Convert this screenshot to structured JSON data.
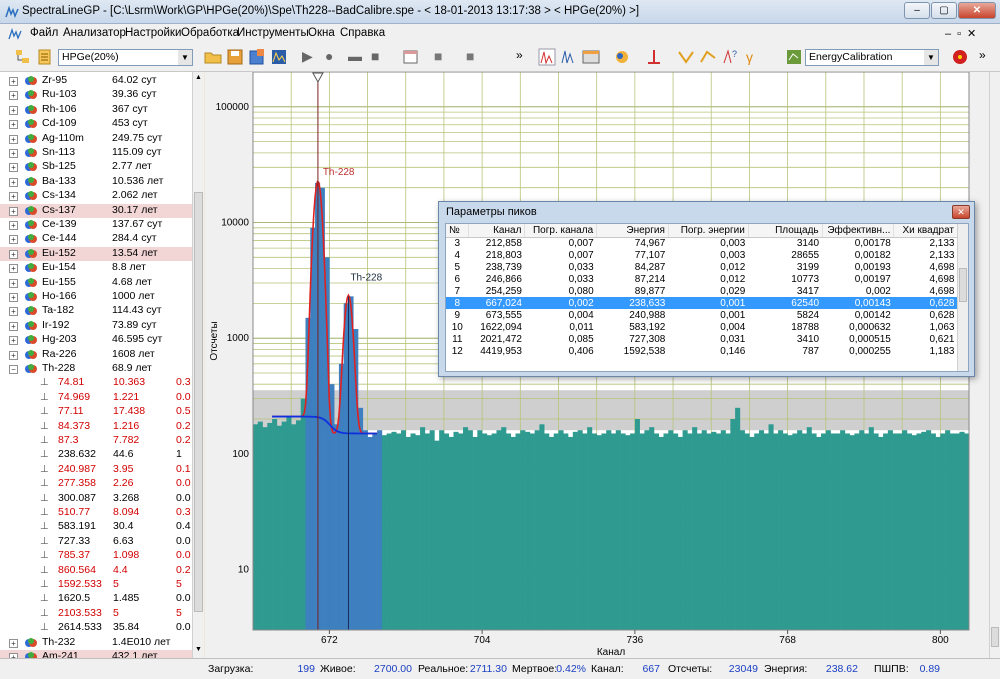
{
  "window": {
    "title": "SpectraLineGP - [C:\\Lsrm\\Work\\GP\\HPGe(20%)\\Spe\\Th228--BadCalibre.spe - < 18-01-2013 13:17:38 > < HPGe(20%) >]",
    "buttons": {
      "minimize": "–",
      "restore": "▢",
      "close": "✕"
    }
  },
  "menu": [
    "Файл",
    "Анализатор",
    "Настройки",
    "Обработка",
    "Инструменты",
    "Окна",
    "Справка"
  ],
  "toolbar": {
    "detector_select": "HPGe(20%)",
    "calibration_select": "EnergyCalibration",
    "overflow": "»"
  },
  "tree": {
    "nuclides": [
      {
        "name": "Zr-95",
        "half_life": "64.02 сут",
        "expanded": false,
        "highlight": false
      },
      {
        "name": "Ru-103",
        "half_life": "39.36 сут",
        "expanded": false,
        "highlight": false
      },
      {
        "name": "Rh-106",
        "half_life": "367 сут",
        "expanded": false,
        "highlight": false
      },
      {
        "name": "Cd-109",
        "half_life": "453 сут",
        "expanded": false,
        "highlight": false
      },
      {
        "name": "Ag-110m",
        "half_life": "249.75 сут",
        "expanded": false,
        "highlight": false
      },
      {
        "name": "Sn-113",
        "half_life": "115.09 сут",
        "expanded": false,
        "highlight": false
      },
      {
        "name": "Sb-125",
        "half_life": "2.77 лет",
        "expanded": false,
        "highlight": false
      },
      {
        "name": "Ba-133",
        "half_life": "10.536 лет",
        "expanded": false,
        "highlight": false
      },
      {
        "name": "Cs-134",
        "half_life": "2.062 лет",
        "expanded": false,
        "highlight": false
      },
      {
        "name": "Cs-137",
        "half_life": "30.17 лет",
        "expanded": false,
        "highlight": true
      },
      {
        "name": "Ce-139",
        "half_life": "137.67 сут",
        "expanded": false,
        "highlight": false
      },
      {
        "name": "Ce-144",
        "half_life": "284.4 сут",
        "expanded": false,
        "highlight": false
      },
      {
        "name": "Eu-152",
        "half_life": "13.54 лет",
        "expanded": false,
        "highlight": true
      },
      {
        "name": "Eu-154",
        "half_life": "8.8 лет",
        "expanded": false,
        "highlight": false
      },
      {
        "name": "Eu-155",
        "half_life": "4.68 лет",
        "expanded": false,
        "highlight": false
      },
      {
        "name": "Ho-166",
        "half_life": "1000 лет",
        "expanded": false,
        "highlight": false
      },
      {
        "name": "Ta-182",
        "half_life": "114.43 сут",
        "expanded": false,
        "highlight": false
      },
      {
        "name": "Ir-192",
        "half_life": "73.89 сут",
        "expanded": false,
        "highlight": false
      },
      {
        "name": "Hg-203",
        "half_life": "46.595 сут",
        "expanded": false,
        "highlight": false
      },
      {
        "name": "Ra-226",
        "half_life": "1608 лет",
        "expanded": false,
        "highlight": false
      },
      {
        "name": "Th-228",
        "half_life": "68.9 лет",
        "expanded": true,
        "highlight": false
      }
    ],
    "th228_lines": [
      {
        "energy": "74.81",
        "intensity": "10.363",
        "extra": "0.3",
        "red": true
      },
      {
        "energy": "74.969",
        "intensity": "1.221",
        "extra": "0.0",
        "red": true
      },
      {
        "energy": "77.11",
        "intensity": "17.438",
        "extra": "0.5",
        "red": true
      },
      {
        "energy": "84.373",
        "intensity": "1.216",
        "extra": "0.2",
        "red": true
      },
      {
        "energy": "87.3",
        "intensity": "7.782",
        "extra": "0.2",
        "red": true
      },
      {
        "energy": "238.632",
        "intensity": "44.6",
        "extra": "1",
        "red": false
      },
      {
        "energy": "240.987",
        "intensity": "3.95",
        "extra": "0.1",
        "red": true
      },
      {
        "energy": "277.358",
        "intensity": "2.26",
        "extra": "0.0",
        "red": true
      },
      {
        "energy": "300.087",
        "intensity": "3.268",
        "extra": "0.0",
        "red": false
      },
      {
        "energy": "510.77",
        "intensity": "8.094",
        "extra": "0.3",
        "red": true
      },
      {
        "energy": "583.191",
        "intensity": "30.4",
        "extra": "0.4",
        "red": false
      },
      {
        "energy": "727.33",
        "intensity": "6.63",
        "extra": "0.0",
        "red": false
      },
      {
        "energy": "785.37",
        "intensity": "1.098",
        "extra": "0.0",
        "red": true
      },
      {
        "energy": "860.564",
        "intensity": "4.4",
        "extra": "0.2",
        "red": true
      },
      {
        "energy": "1592.533",
        "intensity": "5",
        "extra": "5",
        "red": true
      },
      {
        "energy": "1620.5",
        "intensity": "1.485",
        "extra": "0.0",
        "red": false
      },
      {
        "energy": "2103.533",
        "intensity": "5",
        "extra": "5",
        "red": true
      },
      {
        "energy": "2614.533",
        "intensity": "35.84",
        "extra": "0.0",
        "red": false
      }
    ],
    "nuclides_after": [
      {
        "name": "Th-232",
        "half_life": "1.4E010 лет",
        "expanded": false,
        "highlight": false
      },
      {
        "name": "Am-241",
        "half_life": "432.1 лет",
        "expanded": false,
        "highlight": true
      }
    ]
  },
  "chart_data": {
    "type": "bar",
    "title": "",
    "xlabel": "Канал",
    "ylabel": "Отсчеты",
    "y_scale": "log",
    "ylim": [
      3,
      200000
    ],
    "xlim": [
      656,
      806
    ],
    "y_ticks": [
      10,
      100,
      1000,
      10000,
      100000
    ],
    "y_tick_labels": [
      "10",
      "100",
      "1000",
      "10000",
      "100000"
    ],
    "x_ticks": [
      672,
      704,
      736,
      768,
      800
    ],
    "series": [
      {
        "values_note": "",
        "x": [
          656,
          657,
          658,
          659,
          660,
          661,
          662,
          663,
          664,
          665,
          666,
          667,
          668,
          669,
          670,
          671,
          672,
          673,
          674,
          675,
          676,
          677,
          678,
          679,
          680,
          681,
          682,
          683,
          684,
          685,
          686,
          687,
          688,
          689,
          690,
          691,
          692,
          693,
          694,
          695,
          696,
          697,
          698,
          699,
          700,
          701,
          702,
          703,
          704,
          705,
          706,
          707,
          708,
          709,
          710,
          711,
          712,
          713,
          714,
          715,
          716,
          717,
          718,
          719,
          720,
          721,
          722,
          723,
          724,
          725,
          726,
          727,
          728,
          729,
          730,
          731,
          732,
          733,
          734,
          735,
          736,
          737,
          738,
          739,
          740,
          741,
          742,
          743,
          744,
          745,
          746,
          747,
          748,
          749,
          750,
          751,
          752,
          753,
          754,
          755,
          756,
          757,
          758,
          759,
          760,
          761,
          762,
          763,
          764,
          765,
          766,
          767,
          768,
          769,
          770,
          771,
          772,
          773,
          774,
          775,
          776,
          777,
          778,
          779,
          780,
          781,
          782,
          783,
          784,
          785,
          786,
          787,
          788,
          789,
          790,
          791,
          792,
          793,
          794,
          795,
          796,
          797,
          798,
          799,
          800,
          801,
          802,
          803,
          804,
          805
        ],
        "y": [
          180,
          190,
          170,
          185,
          200,
          175,
          190,
          210,
          180,
          195,
          300,
          1500,
          9000,
          22000,
          20000,
          5000,
          400,
          180,
          600,
          2000,
          2300,
          1200,
          250,
          160,
          140,
          150,
          160,
          145,
          150,
          155,
          150,
          160,
          140,
          150,
          145,
          170,
          150,
          160,
          130,
          160,
          150,
          140,
          155,
          150,
          170,
          160,
          140,
          160,
          150,
          145,
          150,
          160,
          170,
          150,
          140,
          150,
          160,
          155,
          150,
          160,
          180,
          150,
          140,
          150,
          160,
          150,
          140,
          155,
          160,
          150,
          170,
          150,
          145,
          150,
          160,
          150,
          160,
          150,
          145,
          150,
          200,
          150,
          160,
          170,
          150,
          140,
          150,
          160,
          150,
          140,
          160,
          150,
          170,
          150,
          160,
          150,
          155,
          150,
          160,
          150,
          200,
          250,
          160,
          150,
          140,
          150,
          160,
          150,
          180,
          150,
          160,
          150,
          145,
          150,
          160,
          150,
          170,
          150,
          140,
          150,
          160,
          150,
          150,
          160,
          150,
          145,
          150,
          160,
          150,
          170,
          150,
          140,
          150,
          160,
          150,
          150,
          160,
          150,
          145,
          150,
          155,
          160,
          150,
          140,
          150,
          160,
          150,
          150,
          155,
          150
        ]
      }
    ],
    "peak_labels": [
      {
        "text": "Th-228",
        "x": 670
      },
      {
        "text": "Th-228",
        "x": 676
      }
    ]
  },
  "peaks_dialog": {
    "title": "Параметры пиков",
    "columns": [
      "№",
      "Канал",
      "Погр. канала",
      "Энергия",
      "Погр. энергии",
      "Площадь",
      "Эффективн...",
      "Хи квадрат"
    ],
    "rows": [
      [
        "3",
        "212,858",
        "0,007",
        "74,967",
        "0,003",
        "3140",
        "0,00178",
        "2,133"
      ],
      [
        "4",
        "218,803",
        "0,007",
        "77,107",
        "0,003",
        "28655",
        "0,00182",
        "2,133"
      ],
      [
        "5",
        "238,739",
        "0,033",
        "84,287",
        "0,012",
        "3199",
        "0,00193",
        "4,698"
      ],
      [
        "6",
        "246,866",
        "0,033",
        "87,214",
        "0,012",
        "10773",
        "0,00197",
        "4,698"
      ],
      [
        "7",
        "254,259",
        "0,080",
        "89,877",
        "0,029",
        "3417",
        "0,002",
        "4,698"
      ],
      [
        "8",
        "667,024",
        "0,002",
        "238,633",
        "0,001",
        "62540",
        "0,00143",
        "0,628"
      ],
      [
        "9",
        "673,555",
        "0,004",
        "240,988",
        "0,001",
        "5824",
        "0,00142",
        "0,628"
      ],
      [
        "10",
        "1622,094",
        "0,011",
        "583,192",
        "0,004",
        "18788",
        "0,000632",
        "1,063"
      ],
      [
        "11",
        "2021,472",
        "0,085",
        "727,308",
        "0,031",
        "3410",
        "0,000515",
        "0,621"
      ],
      [
        "12",
        "4419,953",
        "0,406",
        "1592,538",
        "0,146",
        "787",
        "0,000255",
        "1,183"
      ]
    ],
    "selected_index": 5
  },
  "status": {
    "load_label": "Загрузка:",
    "load": "199",
    "live_label": "Живое:",
    "live": "2700.00",
    "real_label": "Реальное:",
    "real": "2711.30",
    "dead_label": "Мертвое:",
    "dead": "0.42%",
    "channel_label": "Канал:",
    "channel": "667",
    "counts_label": "Отсчеты:",
    "counts": "23049",
    "energy_label": "Энергия:",
    "energy": "238.62",
    "fwhm_label": "ПШПВ:",
    "fwhm": "0.89"
  }
}
